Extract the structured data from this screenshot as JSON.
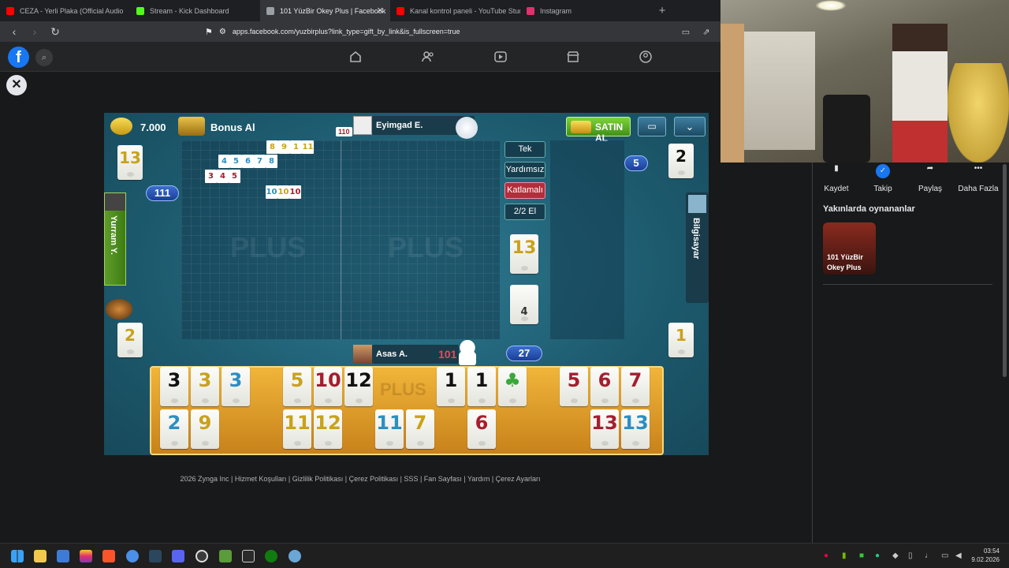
{
  "tabs": [
    {
      "title": "CEZA - Yerli Plaka (Official Audio",
      "color": "#ff0000"
    },
    {
      "title": "Stream - Kick Dashboard",
      "color": "#53fc18"
    },
    {
      "title": "101 YüzBir Okey Plus | Facebook",
      "color": "#9aa0a6"
    },
    {
      "title": "Kanal kontrol paneli - YouTube Studio",
      "color": "#ff0000"
    },
    {
      "title": "Instagram",
      "color": "#e1306c"
    }
  ],
  "url": "apps.facebook.com/yuzbirplus?link_type=gift_by_link&is_fullscreen=true",
  "game": {
    "coins": "7.000",
    "bonus_label": "Bonus Al",
    "buy_label": "SATIN AL",
    "top_player": "Eyimgad E.",
    "top_player_mini": "110",
    "left_player": "Yurram Y.",
    "right_player": "Bilgisayar",
    "bottom_player": "Asas A.",
    "bottom_score": "101",
    "left_score_badge": "111",
    "right_count_badge": "5",
    "deck_count": "27",
    "left_top_tile": "13",
    "left_bottom_tile": "2",
    "right_top_tile": "2",
    "right_bottom_tile": "1",
    "indicator_tile": "13",
    "draw_tile": "4",
    "options": [
      "Tek",
      "Yardımsız",
      "Katlamalı",
      "2/2 El"
    ],
    "board_sets": [
      {
        "tiles": [
          "8",
          "9",
          "1",
          "11"
        ],
        "colors": [
          "#c9a21b",
          "#c9a21b",
          "#c9a21b",
          "#c9a21b"
        ]
      },
      {
        "tiles": [
          "4",
          "5",
          "6",
          "7",
          "8"
        ],
        "colors": [
          "#2a8fc2",
          "#2a8fc2",
          "#2a8fc2",
          "#2a8fc2",
          "#2a8fc2"
        ]
      },
      {
        "tiles": [
          "3",
          "4",
          "5"
        ],
        "colors": [
          "#a51e2e",
          "#a51e2e",
          "#a51e2e"
        ]
      },
      {
        "tiles": [
          "10",
          "10",
          "10"
        ],
        "colors": [
          "#2a8fc2",
          "#c9a21b",
          "#a51e2e"
        ]
      }
    ],
    "rack_top": [
      {
        "v": "3",
        "c": "#111"
      },
      {
        "v": "3",
        "c": "#c9a21b"
      },
      {
        "v": "3",
        "c": "#2a8fc2"
      },
      {
        "v": "5",
        "c": "#c9a21b"
      },
      {
        "v": "10",
        "c": "#a51e2e"
      },
      {
        "v": "12",
        "c": "#111"
      },
      {
        "v": "1",
        "c": "#111"
      },
      {
        "v": "1",
        "c": "#111"
      },
      {
        "v": "♣",
        "c": "#3aa83a"
      },
      {
        "v": "5",
        "c": "#a51e2e"
      },
      {
        "v": "6",
        "c": "#a51e2e"
      },
      {
        "v": "7",
        "c": "#a51e2e"
      }
    ],
    "rack_bottom": [
      {
        "v": "2",
        "c": "#2a8fc2"
      },
      {
        "v": "9",
        "c": "#c9a21b"
      },
      {
        "v": "11",
        "c": "#c9a21b"
      },
      {
        "v": "12",
        "c": "#c9a21b"
      },
      {
        "v": "11",
        "c": "#2a8fc2"
      },
      {
        "v": "7",
        "c": "#c9a21b"
      },
      {
        "v": "6",
        "c": "#a51e2e"
      },
      {
        "v": "13",
        "c": "#a51e2e"
      },
      {
        "v": "13",
        "c": "#2a8fc2"
      }
    ],
    "watermark": "PLUS"
  },
  "footer": "2026 Zynga Inc | Hizmet Koşulları | Gizlilik Politikası | Çerez Politikası | SSS | Fan Sayfası | Yardım | Çerez Ayarları",
  "sidebar": {
    "actions": [
      "Kaydet",
      "Takip",
      "Paylaş",
      "Daha Fazla"
    ],
    "recent_title": "Yakınlarda oynananlar",
    "recent_game_line1": "101 YüzBir",
    "recent_game_line2": "Okey Plus"
  },
  "taskbar": {
    "time": "03:54",
    "date": "9.02.2026"
  }
}
